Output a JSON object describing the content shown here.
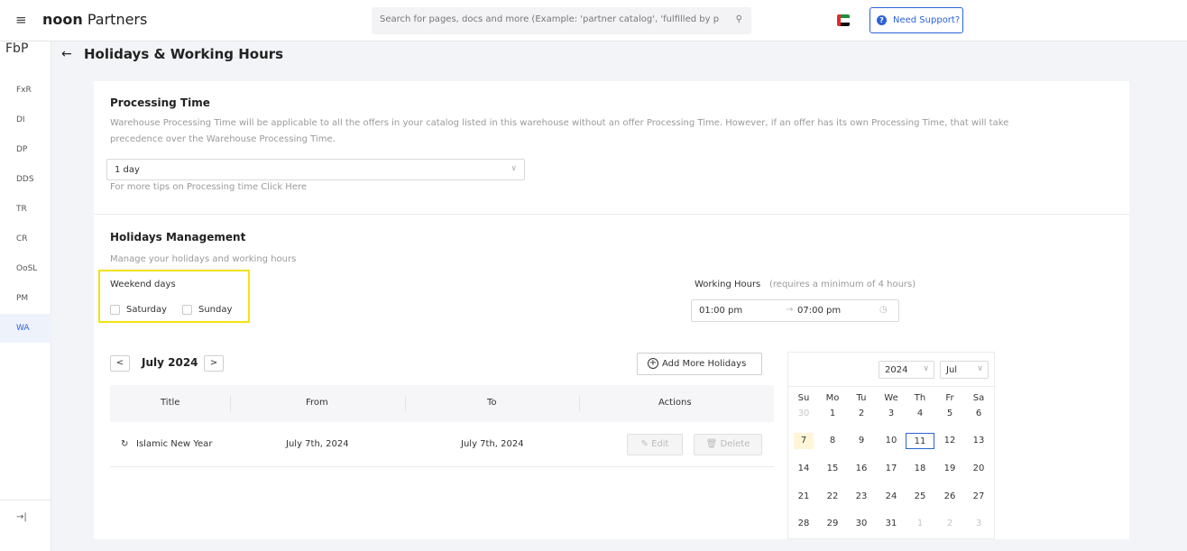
{
  "topbar": {
    "menu_icon": "hamburger-icon",
    "logo_bold": "noon",
    "logo_rest": "Partners",
    "search_placeholder": "Search for pages, docs and more (Example: 'partner catalog', 'fulfilled by p",
    "search_icon": "search-icon",
    "support_label": "Need Support?",
    "support_icon": "?",
    "flag_colors": [
      "#e32b2b",
      "#1d8f3a",
      "#ffffff",
      "#111111"
    ]
  },
  "sidebar": {
    "title": "FbP",
    "items": [
      {
        "label": "FxR",
        "active": false
      },
      {
        "label": "DI",
        "active": false
      },
      {
        "label": "DP",
        "active": false
      },
      {
        "label": "DDS",
        "active": false
      },
      {
        "label": "TR",
        "active": false
      },
      {
        "label": "CR",
        "active": false
      },
      {
        "label": "OoSL",
        "active": false
      },
      {
        "label": "PM",
        "active": false
      },
      {
        "label": "WA",
        "active": true
      }
    ],
    "collapse_glyph": "→|"
  },
  "header": {
    "back_glyph": "←",
    "title": "Holidays & Working Hours"
  },
  "processing": {
    "title": "Processing Time",
    "description_line1": "Warehouse Processing Time will be applicable to all the offers in your catalog listed in this warehouse without an offer Processing Time. However, if an offer has its own Processing Time, that will take",
    "description_line2": "precedence over the Warehouse Processing Time.",
    "select_value": "1 day",
    "tip": "For more tips on Processing time Click Here"
  },
  "holidays": {
    "title": "Holidays Management",
    "subtitle": "Manage your holidays and working hours",
    "weekend_label": "Weekend days",
    "weekend_options": [
      "Saturday",
      "Sunday"
    ],
    "working_hours_label": "Working Hours",
    "working_hours_hint": "(requires a minimum of 4 hours)",
    "start_time": "01:00 pm",
    "end_time": "07:00 pm",
    "range_glyph": "→",
    "clock_glyph": "◷"
  },
  "table": {
    "prev_glyph": "<",
    "next_glyph": ">",
    "month": "July 2024",
    "add_label": "Add More Holidays",
    "add_glyph": "+",
    "columns": [
      "Title",
      "From",
      "To",
      "Actions"
    ],
    "rows": [
      {
        "title": "Islamic New Year",
        "from": "July 7th, 2024",
        "to": "July 7th, 2024",
        "edit": "Edit",
        "delete": "Delete",
        "edit_glyph": "✎",
        "delete_glyph": "🗑",
        "loading_glyph": "↻"
      }
    ]
  },
  "calendar": {
    "year": "2024",
    "month": "Jul",
    "chevron": "∨",
    "weekdays": [
      "Su",
      "Mo",
      "Tu",
      "We",
      "Th",
      "Fr",
      "Sa"
    ],
    "weeks": [
      [
        "30",
        "1",
        "2",
        "3",
        "4",
        "5",
        "6"
      ],
      [
        "7",
        "8",
        "9",
        "10",
        "11",
        "12",
        "13"
      ],
      [
        "14",
        "15",
        "16",
        "17",
        "18",
        "19",
        "20"
      ],
      [
        "21",
        "22",
        "23",
        "24",
        "25",
        "26",
        "27"
      ],
      [
        "28",
        "29",
        "30",
        "31",
        "1",
        "2",
        "3"
      ]
    ],
    "today": "7",
    "selected": "11",
    "accent": "#2d62d6"
  }
}
